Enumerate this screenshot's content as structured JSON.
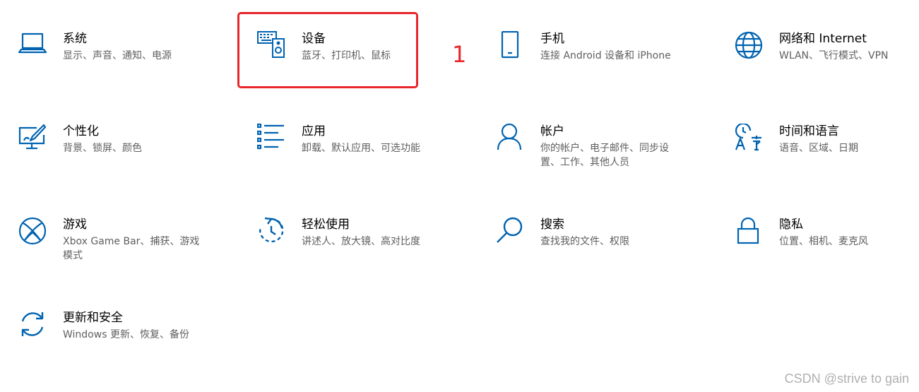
{
  "accent_color": "#0063b1",
  "annotation": {
    "number": "1",
    "color": "#e8262b"
  },
  "watermark": "CSDN @strive to gain",
  "tiles": {
    "system": {
      "title": "系统",
      "desc": "显示、声音、通知、电源",
      "icon": "laptop-icon"
    },
    "devices": {
      "title": "设备",
      "desc": "蓝牙、打印机、鼠标",
      "icon": "keyboard-speaker-icon"
    },
    "phone": {
      "title": "手机",
      "desc": "连接 Android 设备和 iPhone",
      "icon": "phone-icon"
    },
    "network": {
      "title": "网络和 Internet",
      "desc": "WLAN、飞行模式、VPN",
      "icon": "globe-icon"
    },
    "personalization": {
      "title": "个性化",
      "desc": "背景、锁屏、颜色",
      "icon": "paint-monitor-icon"
    },
    "apps": {
      "title": "应用",
      "desc": "卸载、默认应用、可选功能",
      "icon": "app-list-icon"
    },
    "accounts": {
      "title": "帐户",
      "desc": "你的帐户、电子邮件、同步设置、工作、其他人员",
      "icon": "person-icon"
    },
    "time_language": {
      "title": "时间和语言",
      "desc": "语音、区域、日期",
      "icon": "time-language-icon"
    },
    "gaming": {
      "title": "游戏",
      "desc": "Xbox Game Bar、捕获、游戏模式",
      "icon": "xbox-icon"
    },
    "ease_of_access": {
      "title": "轻松使用",
      "desc": "讲述人、放大镜、高对比度",
      "icon": "ease-of-access-icon"
    },
    "search": {
      "title": "搜索",
      "desc": "查找我的文件、权限",
      "icon": "search-icon"
    },
    "privacy": {
      "title": "隐私",
      "desc": "位置、相机、麦克风",
      "icon": "lock-icon"
    },
    "update_security": {
      "title": "更新和安全",
      "desc": "Windows 更新、恢复、备份",
      "icon": "sync-icon"
    }
  }
}
